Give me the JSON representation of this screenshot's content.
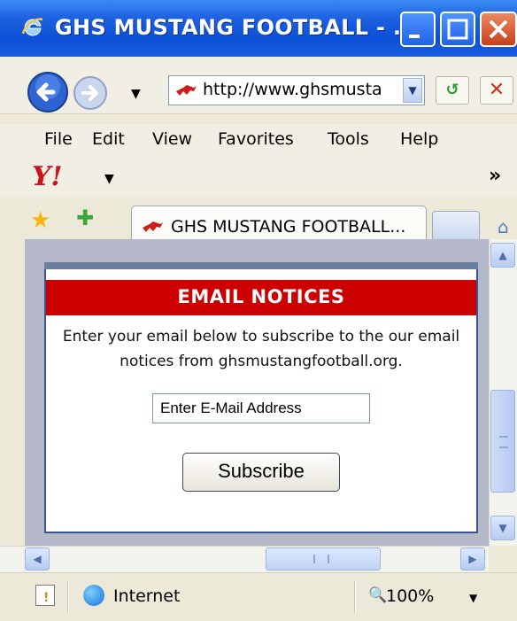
{
  "window": {
    "title": "GHS MUSTANG FOOTBALL - ..."
  },
  "navbar": {
    "address": "http://www.ghsmusta"
  },
  "menu": {
    "file": "File",
    "edit": "Edit",
    "view": "View",
    "favorites": "Favorites",
    "tools": "Tools",
    "help": "Help"
  },
  "yahoo": {
    "logo": "Y!",
    "overflow": "»"
  },
  "tabs": {
    "active_label": "GHS MUSTANG FOOTBALL..."
  },
  "widget": {
    "title": "EMAIL NOTICES",
    "description": "Enter your email below to subscribe to the our email notices from ghsmustangfootball.org.",
    "input_value": "Enter E-Mail Address",
    "button_label": "Subscribe"
  },
  "status": {
    "zone": "Internet",
    "zoom": "100%"
  },
  "colors": {
    "header_red": "#cc0000",
    "titlebar_blue": "#0a4fd6",
    "widget_border": "#385591"
  }
}
